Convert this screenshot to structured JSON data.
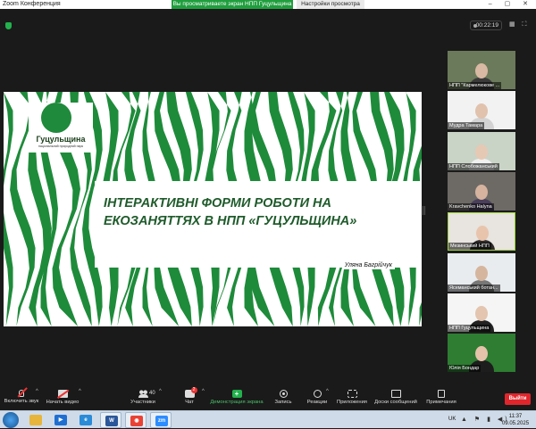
{
  "window": {
    "app_title": "Zoom Конференция",
    "share_banner": "Вы просматриваете экран НПП Гуцульщина",
    "view_options": "Настройки просмотра",
    "window_controls": "‒ ▢ ✕"
  },
  "meeting_bar": {
    "timer": "00:22:19",
    "view_buttons": "▦ ⛶"
  },
  "slide": {
    "logo_title": "Гуцульщина",
    "logo_subtitle": "національний природний парк",
    "title": "ІНТЕРАКТИВНІ ФОРМИ РОБОТИ НА ЕКОЗАНЯТТЯХ В НПП «ГУЦУЛЬЩИНА»",
    "author": "Уляна Багрійчук",
    "stripe_color": "#1e8b3a"
  },
  "participants": [
    {
      "name": "НПП \"Кармелюкове ...",
      "bg": "#6b7a5a",
      "face": "#d9b9a3",
      "body": "#3a3a3a"
    },
    {
      "name": "Мудра Тамара",
      "bg": "#f2f2f2",
      "face": "#e0c2ad",
      "body": "#d3d3d3"
    },
    {
      "name": "НПП Слобожанський",
      "bg": "#c9d3c6",
      "face": "#e6c9b5",
      "body": "#f0f0f0"
    },
    {
      "name": "Kravchenko Halyna",
      "bg": "#6d6a66",
      "face": "#d5b39f",
      "body": "#4a3f5a"
    },
    {
      "name": "Мезинський НПП",
      "bg": "#e8e4df",
      "face": "#e8c4ad",
      "body": "#2e2a2a"
    },
    {
      "name": "Ясеманський ботан...",
      "bg": "#e9ecef",
      "face": "#d6b59e",
      "body": "#777"
    },
    {
      "name": "НПП Гуцульщина",
      "bg": "#f5f5f5",
      "face": "#e3c5b0",
      "body": "#222"
    },
    {
      "name": "Юлія Бондар",
      "bg": "#2e7d32",
      "face": "#e4c3aa",
      "body": "#1d1d1d"
    }
  ],
  "toolbar": {
    "mute": "Включить звук",
    "video": "Начать видео",
    "participants": "Участники",
    "participants_count": "40",
    "chat": "Чат",
    "chat_badge": "2",
    "share": "Демонстрация экрана",
    "record": "Запись",
    "reactions": "Реакции",
    "apps": "Приложения",
    "whiteboards": "Доски сообщений",
    "notes": "Примечания",
    "leave": "Выйти"
  },
  "taskbar": {
    "apps": [
      {
        "icon": "folder-icon",
        "color": "#e7b53b",
        "glyph": ""
      },
      {
        "icon": "media-player-icon",
        "color": "#1f6fd1",
        "glyph": "▶"
      },
      {
        "icon": "ie-icon",
        "color": "#2a8bd8",
        "glyph": "e"
      },
      {
        "icon": "word-icon",
        "color": "#2b579a",
        "glyph": "W"
      },
      {
        "icon": "chrome-icon",
        "color": "#e94235",
        "glyph": "◉"
      },
      {
        "icon": "zoom-icon",
        "color": "#2d8cff",
        "glyph": "zm"
      }
    ],
    "lang": "UK",
    "time": "11:37",
    "date": "09.05.2025"
  }
}
